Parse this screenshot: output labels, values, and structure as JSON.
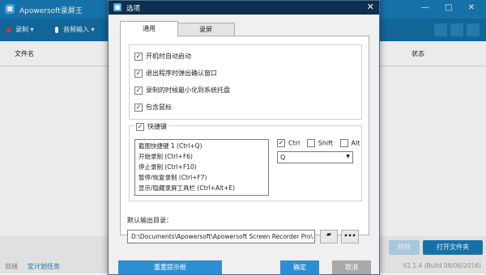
{
  "app": {
    "title": "Apowersoft录屏王",
    "logo_glyph": "■",
    "window_controls": "— □ ✕"
  },
  "toolbar": {
    "record_label": "录制 ▾",
    "audio_label": "音频输入 ▾"
  },
  "list": {
    "col_file": "文件名",
    "col_status": "状态"
  },
  "footer": {
    "remove_label": "移除",
    "open_folder_label": "打开文件夹",
    "status_ready": "就绪",
    "status_plan": "定计划任务",
    "version": "V2.1.4 (Build 08/06/2016)"
  },
  "dialog": {
    "title": "选项",
    "close_glyph": "✕",
    "tabs": [
      {
        "label": "通用"
      },
      {
        "label": "录屏"
      }
    ],
    "options": [
      {
        "label": "开机时自动启动",
        "checked": true,
        "mark": "✓"
      },
      {
        "label": "退出程序时弹出确认窗口",
        "checked": true,
        "mark": "✓"
      },
      {
        "label": "录制的时候最小化到系统托盘",
        "checked": true,
        "mark": "✓"
      },
      {
        "label": "包含鼠标",
        "checked": true,
        "mark": "✓"
      }
    ],
    "hotkeys": {
      "label": "快捷键",
      "enabled_mark": "✓",
      "items": [
        "截图快捷键 1 (Ctrl+Q)",
        "开始录制 (Ctrl+F6)",
        "停止录制 (Ctrl+F10)",
        "暂停/恢复录制 (Ctrl+F7)",
        "显示/隐藏录屏工具栏 (Ctrl+Alt+E)"
      ],
      "modifiers": [
        {
          "label": "Ctrl",
          "checked": true,
          "mark": "✓"
        },
        {
          "label": "Shift",
          "checked": false,
          "mark": ""
        },
        {
          "label": "Alt",
          "checked": false,
          "mark": ""
        }
      ],
      "key_value": "Q",
      "key_arrow": "▼"
    },
    "output": {
      "label": "默认输出目录：",
      "path": "D:\\Documents\\Apowersoft\\Apowersoft Screen Recorder Pro\\",
      "folder_glyph": "▰",
      "browse_glyph": "•••"
    },
    "buttons": {
      "reset": "重置提示框",
      "ok": "确定",
      "cancel": "取消"
    }
  }
}
